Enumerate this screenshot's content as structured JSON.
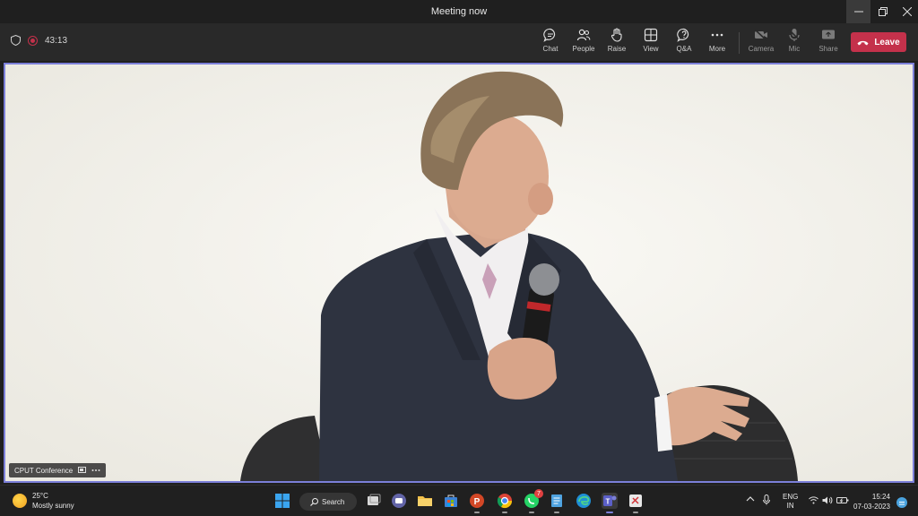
{
  "window": {
    "title": "Meeting now"
  },
  "toolbar": {
    "timer": "43:13",
    "buttons": {
      "chat": "Chat",
      "people": "People",
      "raise": "Raise",
      "view": "View",
      "qa": "Q&A",
      "more": "More",
      "camera": "Camera",
      "mic": "Mic",
      "share": "Share"
    },
    "leave": "Leave"
  },
  "stage": {
    "participant_name": "CPUT Conference"
  },
  "taskbar": {
    "weather": {
      "temp": "25°C",
      "condition": "Mostly sunny"
    },
    "search_label": "Search",
    "whatsapp_badge": "7",
    "language": {
      "top": "ENG",
      "bottom": "IN"
    },
    "clock": {
      "time": "15:24",
      "date": "07-03-2023"
    }
  },
  "colors": {
    "leave": "#c4314b",
    "active_border": "#7b7fd8",
    "teams_purple": "#5b5fc7"
  }
}
